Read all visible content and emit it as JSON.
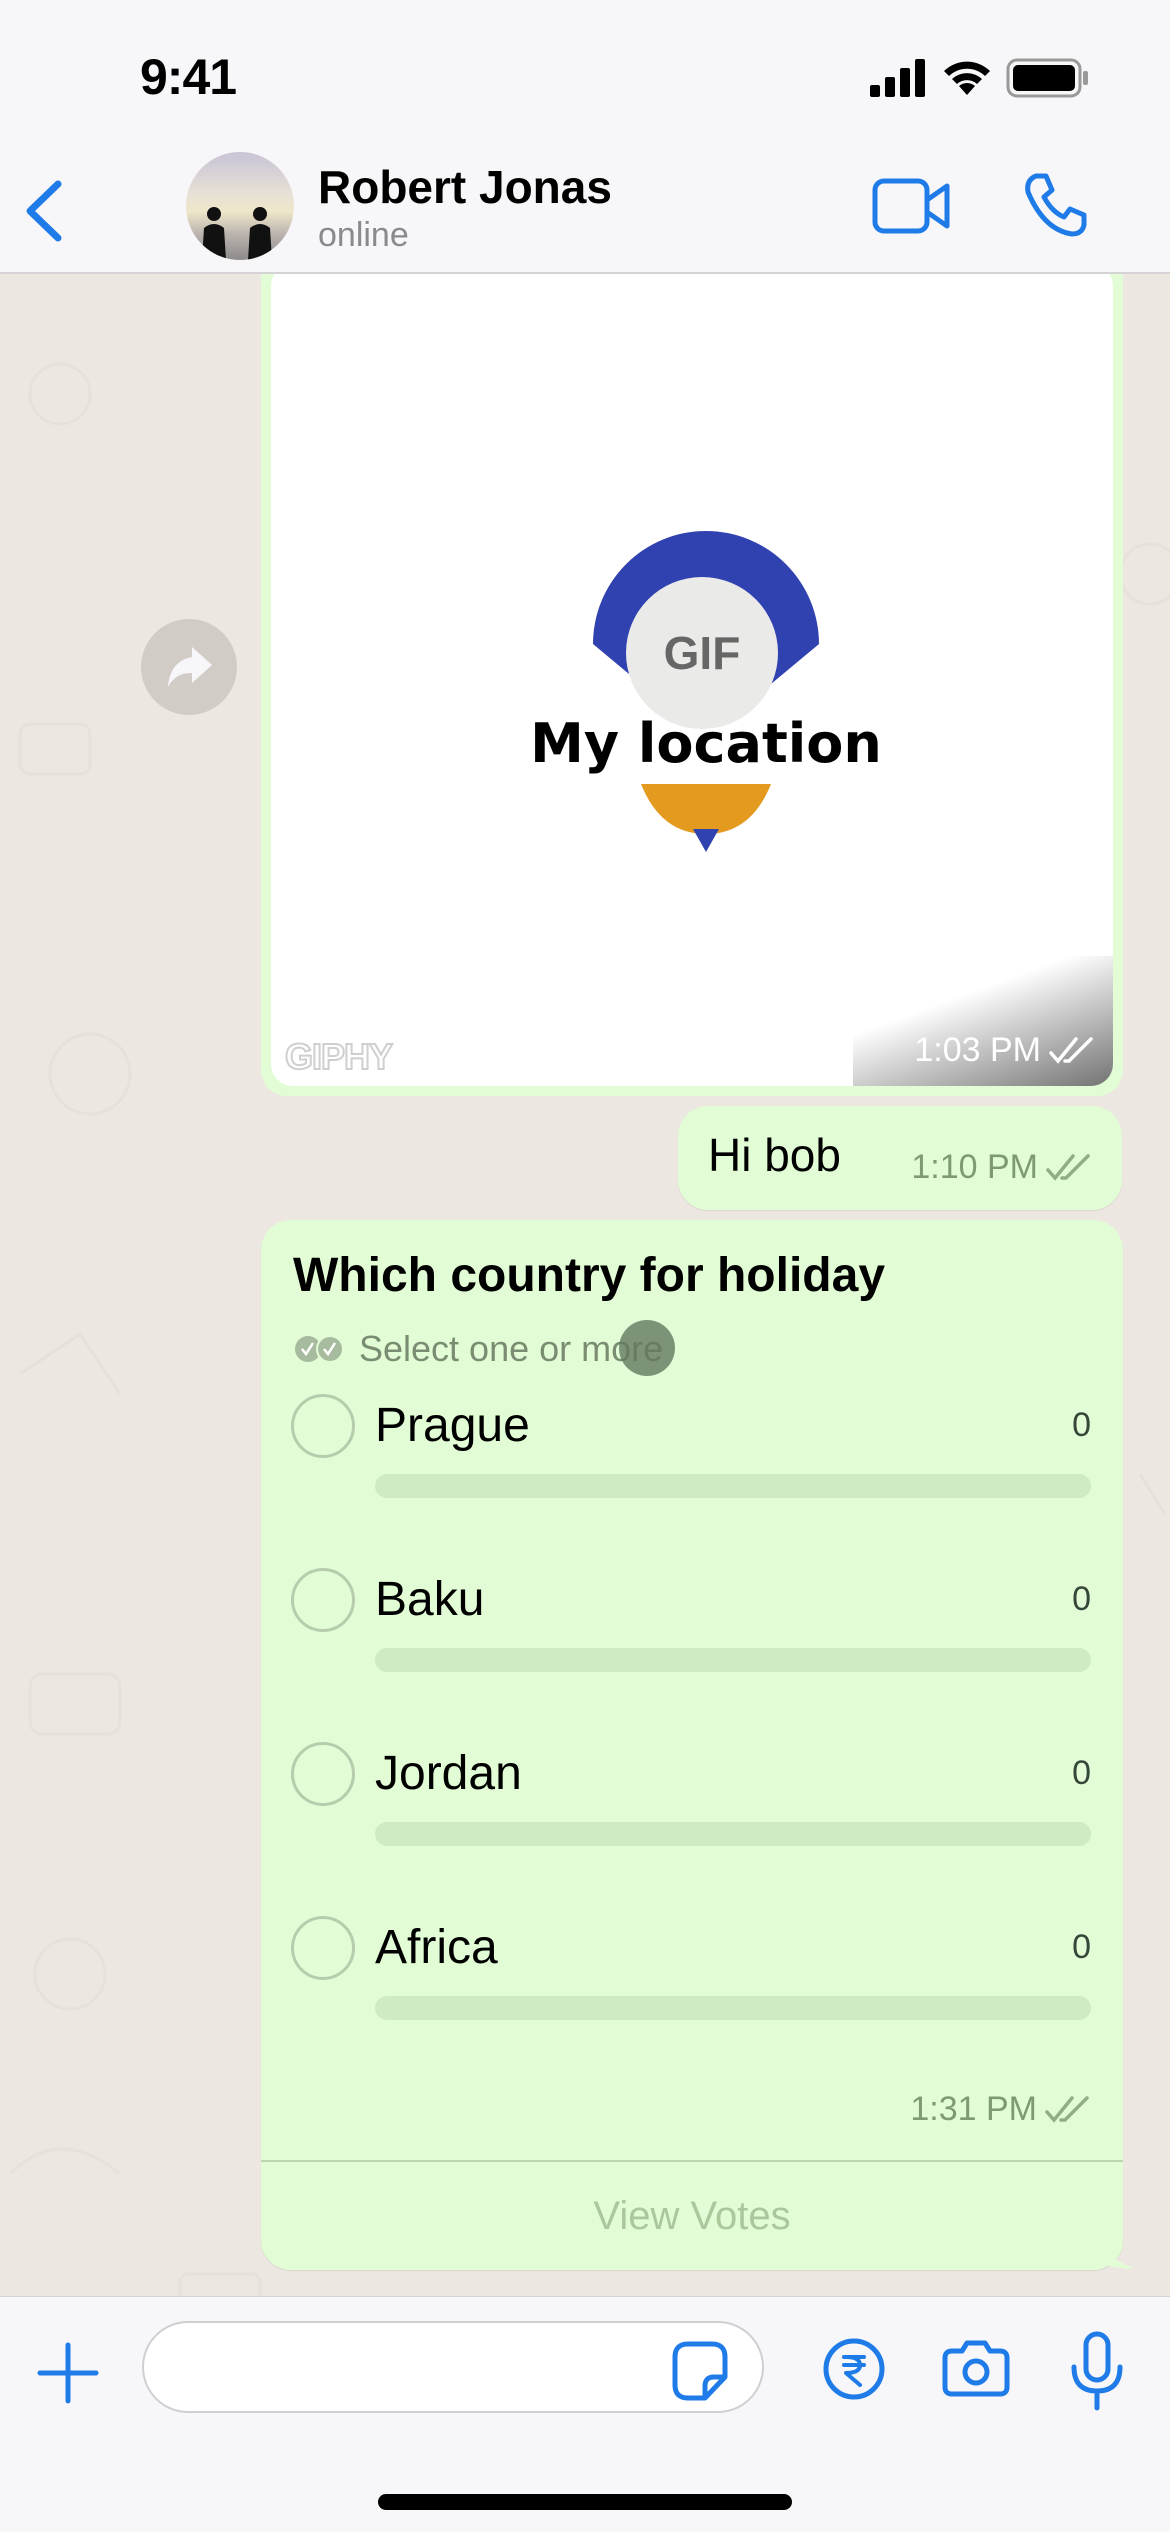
{
  "status_bar": {
    "time": "9:41"
  },
  "header": {
    "contact_name": "Robert Jonas",
    "contact_status": "online",
    "accent_color": "#1f7be8"
  },
  "messages": {
    "gif": {
      "type": "gif",
      "caption_art_text": "My location",
      "badge": "GIF",
      "provider": "GIPHY",
      "time": "1:03 PM",
      "status": "read"
    },
    "text": {
      "type": "text",
      "text": "Hi bob",
      "time": "1:10 PM",
      "status": "delivered"
    },
    "poll": {
      "type": "poll",
      "title": "Which country for holiday",
      "hint": "Select one or more",
      "options": [
        {
          "label": "Prague",
          "votes": "0",
          "fraction": 0
        },
        {
          "label": "Baku",
          "votes": "0",
          "fraction": 0
        },
        {
          "label": "Jordan",
          "votes": "0",
          "fraction": 0
        },
        {
          "label": "Africa",
          "votes": "0",
          "fraction": 0
        }
      ],
      "time": "1:31 PM",
      "status": "delivered",
      "view_votes_label": "View Votes"
    }
  },
  "input_bar": {
    "message_value": "",
    "message_placeholder": ""
  },
  "colors": {
    "bubble_outgoing": "#e2fdd5",
    "chat_background": "#ece7e1",
    "icon_blue": "#1f7be8"
  }
}
